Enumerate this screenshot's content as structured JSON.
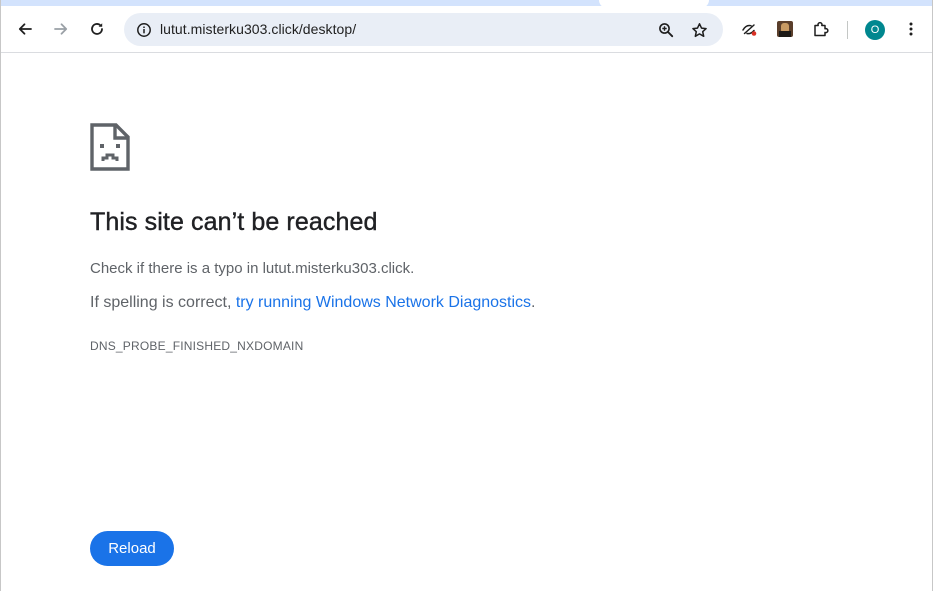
{
  "browser": {
    "address_bar": {
      "url": "lutut.misterku303.click/desktop/"
    },
    "profile_initial": "O",
    "icons": {
      "back": "back-arrow-icon",
      "forward": "forward-arrow-icon",
      "reload": "reload-icon",
      "site_info": "site-info-icon",
      "zoom": "zoom-icon",
      "bookmark": "star-icon",
      "no_tracking": "eye-slash-icon",
      "extension_avatar": "extension-avatar-icon",
      "extensions": "puzzle-icon",
      "menu": "kebab-menu-icon"
    }
  },
  "error_page": {
    "icon": "sad-document-icon",
    "title": "This site can’t be reached",
    "line1": "Check if there is a typo in lutut.misterku303.click.",
    "line2_prefix": "If spelling is correct, ",
    "line2_link": "try running Windows Network Diagnostics",
    "line2_suffix": ".",
    "error_code": "DNS_PROBE_FINISHED_NXDOMAIN",
    "reload_label": "Reload"
  },
  "colors": {
    "accent": "#1a73e8",
    "title": "#202124",
    "body_text": "#5f6368",
    "omnibox_bg": "#e9eef6",
    "tabstrip_bg": "#d3e3fd",
    "profile_bg": "#00878f"
  }
}
